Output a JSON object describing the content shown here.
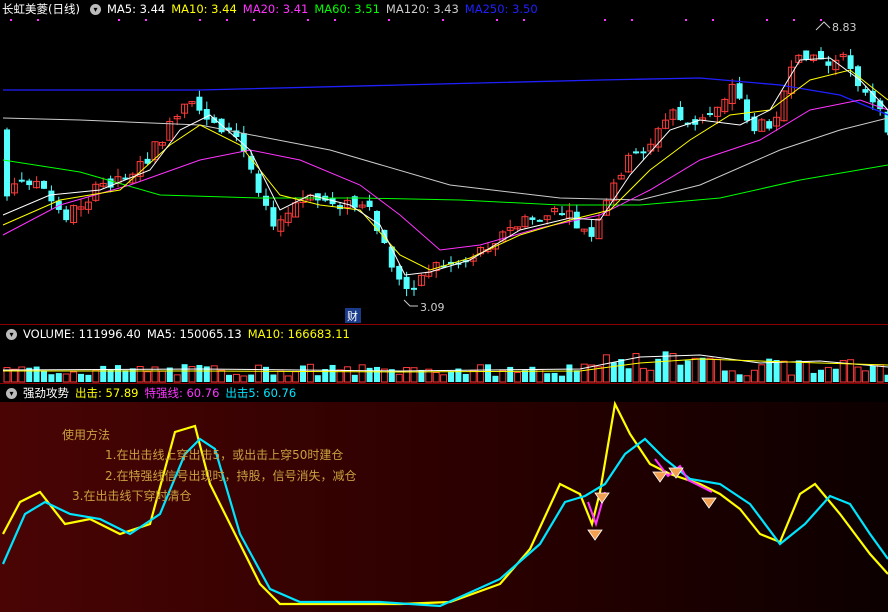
{
  "chart_data": [
    {
      "type": "candlestick",
      "title": "长虹美菱(日线)",
      "indicators": [
        {
          "name": "MA5",
          "label": "MA5: 3.44",
          "color": "#ffffff"
        },
        {
          "name": "MA10",
          "label": "MA10: 3.44",
          "color": "#ffff00"
        },
        {
          "name": "MA20",
          "label": "MA20: 3.41",
          "color": "#ff33ff"
        },
        {
          "name": "MA60",
          "label": "MA60: 3.51",
          "color": "#00ff00"
        },
        {
          "name": "MA120",
          "label": "MA120: 3.43",
          "color": "#cccccc"
        },
        {
          "name": "MA250",
          "label": "MA250: 3.50",
          "color": "#2020ff"
        }
      ],
      "annotations": {
        "high": "8.83",
        "low": "3.09",
        "event_marker": "财"
      },
      "up_color": "#ff3b3b",
      "down_color": "#54ffff"
    },
    {
      "type": "bar",
      "title": "VOLUME",
      "indicators": [
        {
          "name": "VOLUME",
          "label": "VOLUME: 111996.40",
          "color": "#ffffff"
        },
        {
          "name": "MA5",
          "label": "MA5: 150065.13",
          "color": "#ffffff"
        },
        {
          "name": "MA10",
          "label": "MA10: 166683.11",
          "color": "#ffff00"
        }
      ]
    },
    {
      "type": "line",
      "title": "强劲攻势",
      "indicators": [
        {
          "name": "出击",
          "label": "出击: 57.89",
          "color": "#ffff00"
        },
        {
          "name": "特强线",
          "label": "特强线: 60.76",
          "color": "#ff33ff"
        },
        {
          "name": "出击5",
          "label": "出击5: 60.76",
          "color": "#00e5ff"
        }
      ],
      "usage": {
        "title": "使用方法",
        "line1": "1.在出击线上穿出击5，或出击上穿50时建仓",
        "line2": "2.在特强线信号出现时，持股，信号消失，减仓",
        "line3": "3.在出击线下穿时清仓"
      }
    }
  ]
}
